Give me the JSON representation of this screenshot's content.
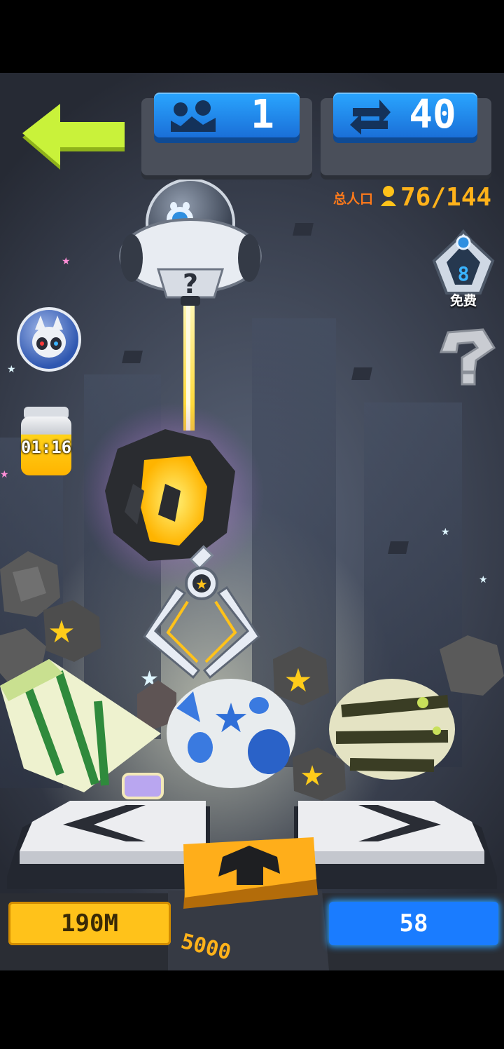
{
  "hud": {
    "level_value": "1",
    "swaps_value": "40",
    "population_label": "总人口",
    "population_value": "76/144"
  },
  "side": {
    "free_count": "8",
    "free_label": "免费",
    "mystery_symbol": "?",
    "timer": "01:16"
  },
  "bottom": {
    "depth": "190M",
    "claw_cost": "5000",
    "gems": "58"
  },
  "icons": {
    "back": "arrow-left-icon",
    "level": "mountain-level-icon",
    "swaps": "swap-arrows-icon",
    "population": "person-icon",
    "claw": "claw-icon"
  },
  "colors": {
    "back_arrow": "#c9f23a",
    "hud_blue": "#1f8bf0",
    "depth_pill": "#ffc21a",
    "gems_pill": "#1a7cff",
    "claw_button": "#ffae1a",
    "population_orange": "#ff7a1a"
  }
}
